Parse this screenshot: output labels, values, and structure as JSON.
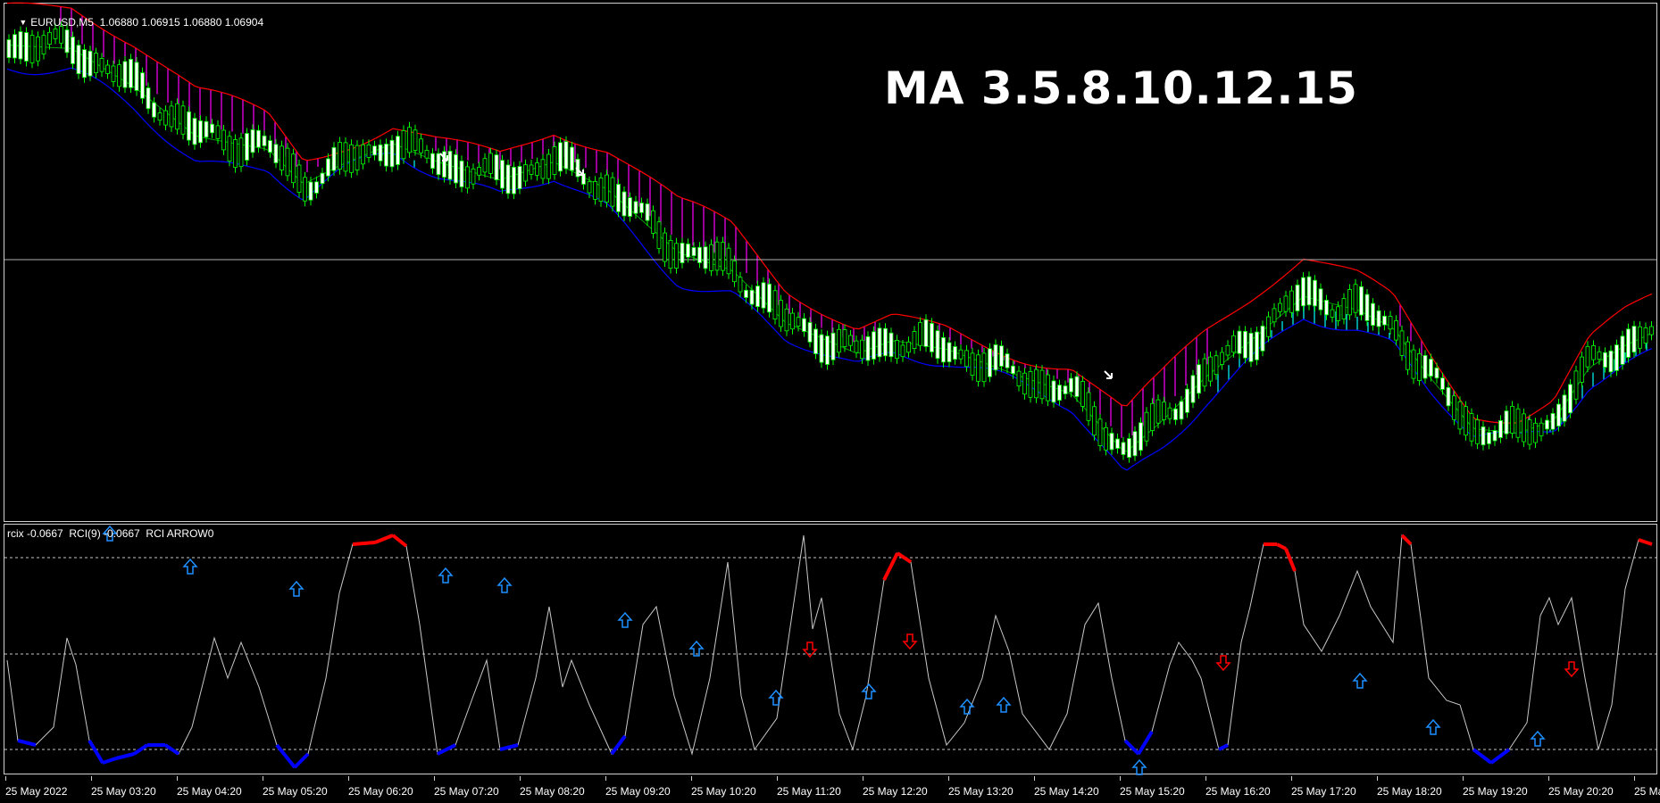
{
  "main_chart": {
    "symbol_caption": "EURUSD,M5  1.06880 1.06915 1.06880 1.06904",
    "overlay_title": "MA 3.5.8.10.12.15",
    "colors": {
      "background": "#000000",
      "bull_candle": "#ffffff",
      "wick": "#00ff00",
      "upper_band": "#ff0000",
      "lower_band": "#0000ff",
      "middle_line": "#00a000",
      "cloud_bear": "#ff00ff",
      "cloud_bull": "#00ffff",
      "price_line": "#b0b0b0"
    }
  },
  "sub_chart": {
    "caption": "rcix -0.0667  RCI(9) -0.0667  RCI ARROW0",
    "colors": {
      "line": "#c8c8c8",
      "overbought": "#ff0000",
      "oversold": "#0000ff",
      "arrow_up": "#1e90ff",
      "arrow_down": "#ff0000",
      "level_line": "#c8c8c8"
    },
    "icons": {
      "arrow_up": "arrow-up-icon",
      "arrow_down": "arrow-down-icon"
    }
  },
  "time_axis": {
    "labels": [
      "25 May 2022",
      "25 May 03:20",
      "25 May 04:20",
      "25 May 05:20",
      "25 May 06:20",
      "25 May 07:20",
      "25 May 08:20",
      "25 May 09:20",
      "25 May 10:20",
      "25 May 11:20",
      "25 May 12:20",
      "25 May 13:20",
      "25 May 14:20",
      "25 May 15:20",
      "25 May 16:20",
      "25 May 17:20",
      "25 May 18:20",
      "25 May 19:20",
      "25 May 20:20",
      "25 Ma"
    ]
  }
}
